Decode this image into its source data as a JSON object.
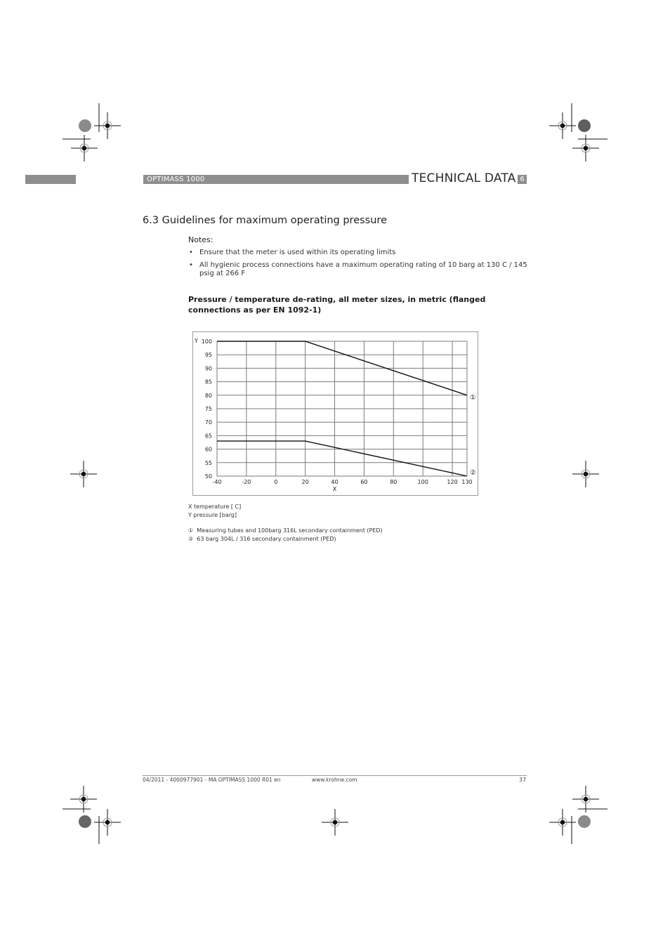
{
  "header": {
    "product": "OPTIMASS 1000",
    "section": "TECHNICAL DATA",
    "chapter": "6"
  },
  "section_title": "6.3  Guidelines for maximum operating pressure",
  "notes": {
    "label": "Notes:",
    "bullet_glyph": "•",
    "items": [
      "Ensure that the meter is used within its operating limits",
      "All hygienic process connections have a maximum operating rating of 10 barg at 130  C / 145 psig at 266  F"
    ]
  },
  "chart_heading": "Pressure / temperature de-rating, all meter sizes, in metric (flanged connections as per EN 1092-1)",
  "chart_data": {
    "type": "line",
    "title": "Pressure / temperature de-rating, all meter sizes, in metric (flanged connections as per EN 1092-1)",
    "xlabel": "X",
    "ylabel": "Y",
    "xlim": [
      -40,
      130
    ],
    "ylim": [
      50,
      100
    ],
    "grid": true,
    "x_ticks": [
      -40,
      -20,
      0,
      20,
      40,
      60,
      80,
      100,
      120,
      130
    ],
    "y_ticks": [
      50,
      55,
      60,
      65,
      70,
      75,
      80,
      85,
      90,
      95,
      100
    ],
    "series": [
      {
        "name": "1",
        "marker_label": "①",
        "x": [
          -40,
          20,
          130
        ],
        "y": [
          100,
          100,
          80
        ]
      },
      {
        "name": "2",
        "marker_label": "②",
        "x": [
          -40,
          20,
          130
        ],
        "y": [
          63,
          63,
          50
        ]
      }
    ]
  },
  "legend": {
    "x_desc": "X temperature [  C]",
    "y_desc": "Y pressure [barg]",
    "items": [
      {
        "marker": "①",
        "text": "Measuring tubes and 100barg 316L secondary containment (PED)"
      },
      {
        "marker": "②",
        "text": "63 barg 304L / 316 secondary containment (PED)"
      }
    ]
  },
  "footer": {
    "doc": "04/2011 - 4000977901 - MA OPTIMASS 1000 R01 en",
    "url": "www.krohne.com",
    "page": "37"
  },
  "colors": {
    "band": "#8e8e8e",
    "line": "#111111",
    "grid": "#7a7a7a"
  }
}
